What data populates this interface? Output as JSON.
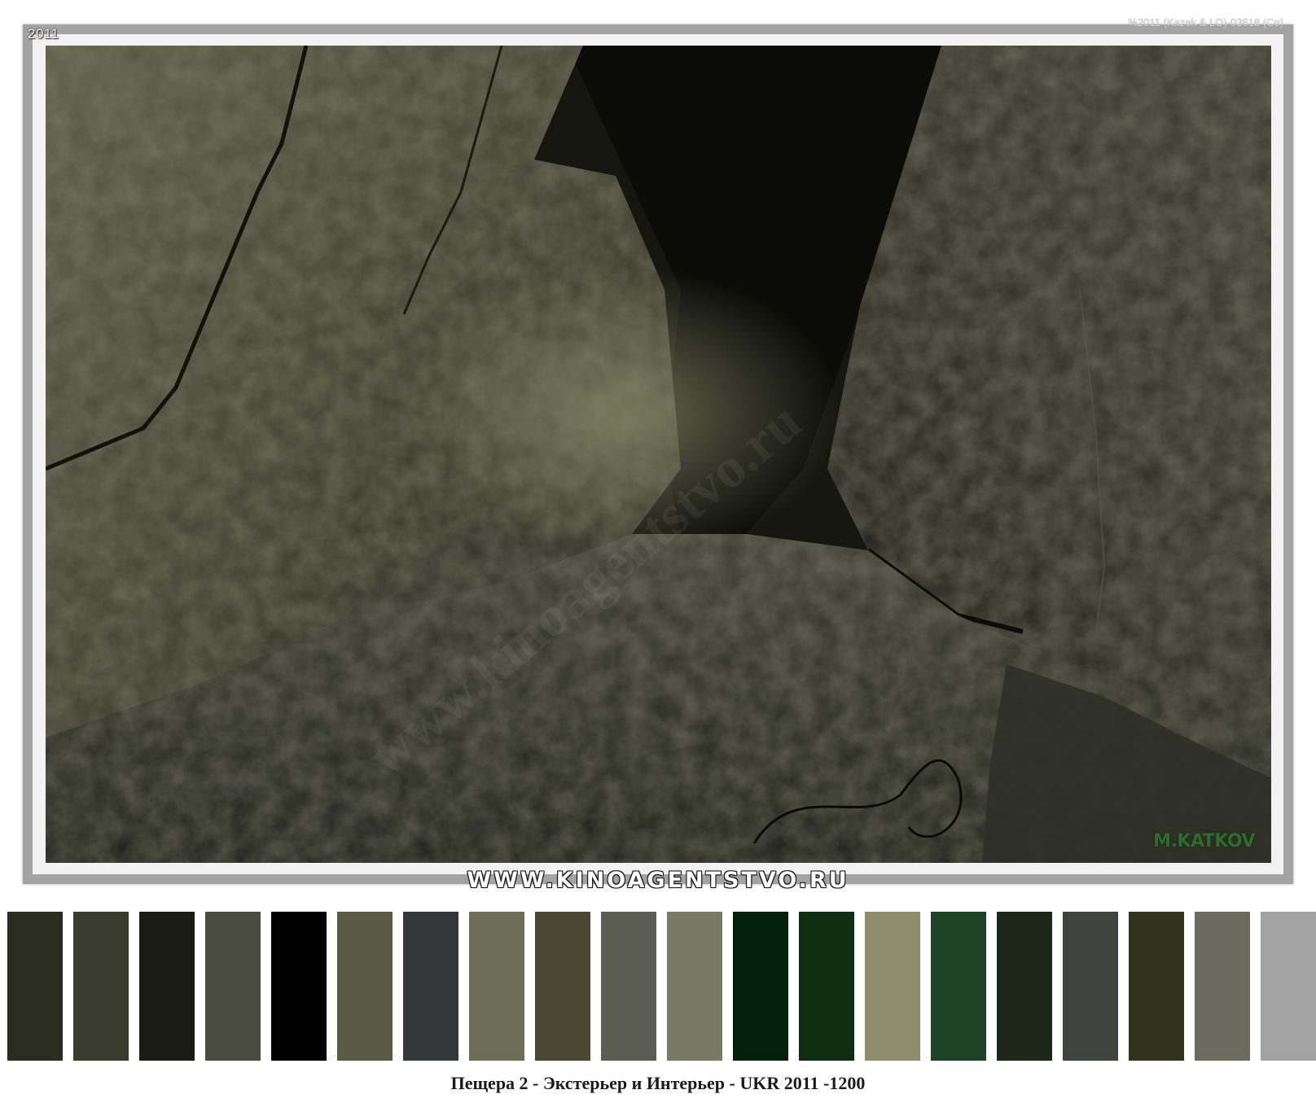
{
  "photo": {
    "year_label": "2011",
    "copyright_label": "%2011 (Kazek & LO)-03618 (Co)",
    "signature": "M.KATKOV",
    "watermark": "www.kinoagentstvo.ru"
  },
  "site_banner": "WWW.KINOAGENTSTVO.RU",
  "palette": {
    "colors": [
      "#2b2c20",
      "#3a3c2e",
      "#1b1c14",
      "#4a4c40",
      "#000000",
      "#5a5a45",
      "#34363a",
      "#6e6e57",
      "#4a4832",
      "#5c5d52",
      "#7a7a62",
      "#03200a",
      "#0f2d10",
      "#8d8d6d",
      "#1f4327",
      "#1c2619",
      "#41433e",
      "#33321b",
      "#6b6b5e",
      "#a2a2a2"
    ]
  },
  "caption": "Пещера 2 - Экстерьер и Интерьер - UKR 2011 -1200"
}
